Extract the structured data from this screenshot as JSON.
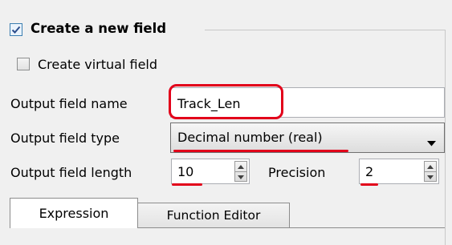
{
  "group": {
    "title": "Create a new field",
    "checked": true
  },
  "virtual_field": {
    "label": "Create virtual field",
    "checked": false
  },
  "output_name": {
    "label": "Output field name",
    "value": "Track_Len"
  },
  "output_type": {
    "label": "Output field type",
    "selected": "Decimal number (real)"
  },
  "output_length": {
    "label": "Output field length",
    "value": "10"
  },
  "precision": {
    "label": "Precision",
    "value": "2"
  },
  "tabs": [
    {
      "label": "Expression",
      "active": true
    },
    {
      "label": "Function Editor",
      "active": false
    }
  ],
  "annotation_color": "#e2001a"
}
